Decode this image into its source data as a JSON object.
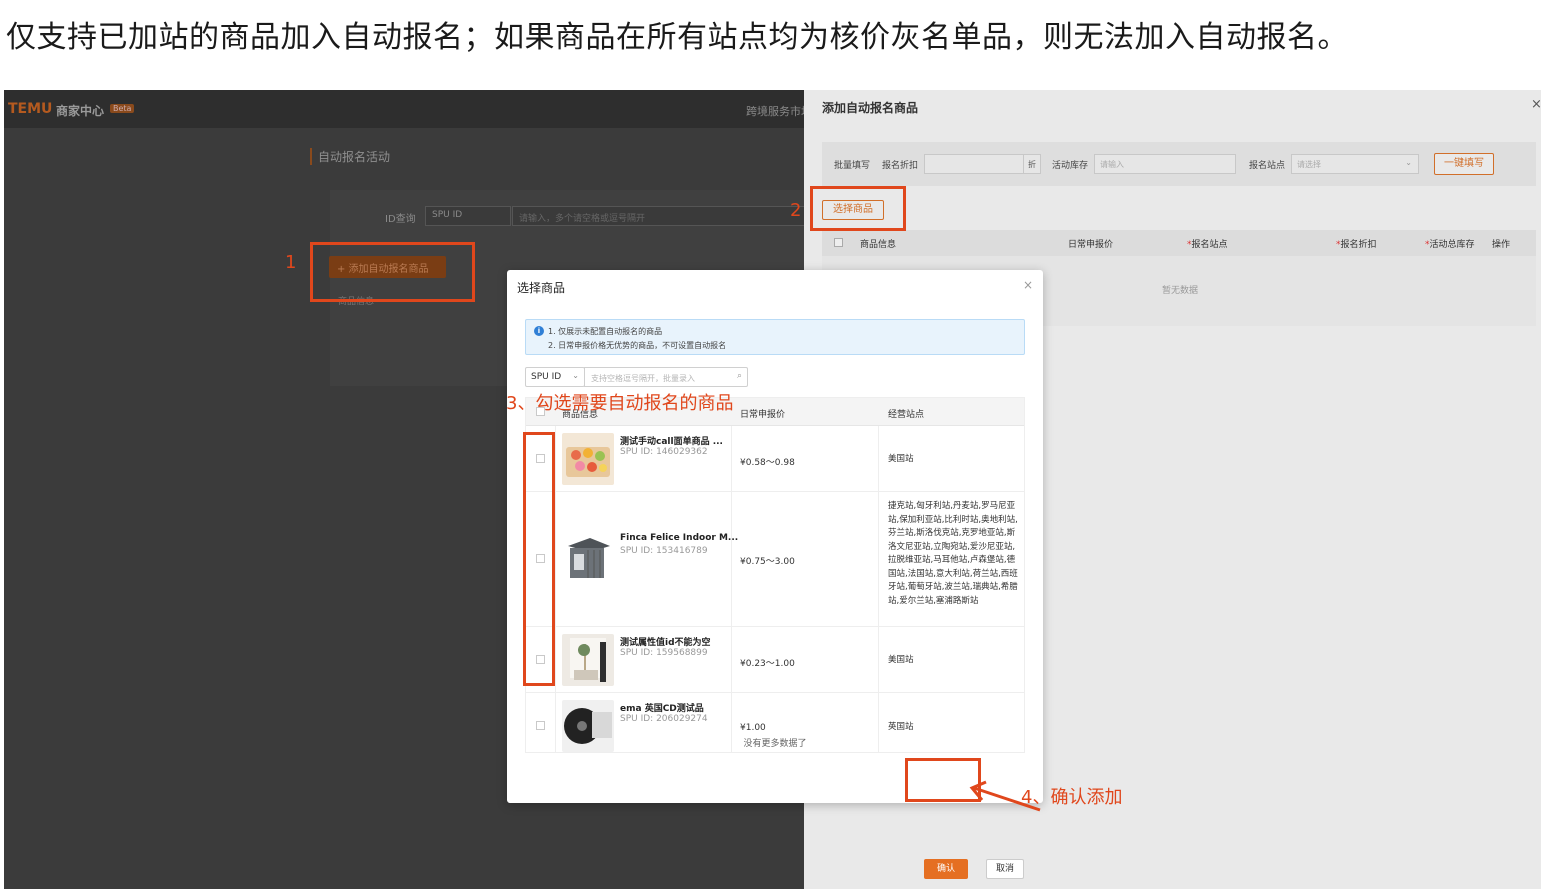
{
  "instruction": "仅支持已加站的商品加入自动报名；如果商品在所有站点均为核价灰名单品，则无法加入自动报名。",
  "base": {
    "logo": "TEMU",
    "brand": "商家中心",
    "beta": "Beta",
    "cross_service": "跨境服务市场",
    "page_title": "自动报名活动",
    "id_label": "ID查询",
    "id_select": "SPU ID",
    "id_placeholder": "请输入，多个请空格或逗号隔开",
    "add_button": "+ 添加自动报名商品",
    "col_header": "商品信息"
  },
  "drawer": {
    "title": "添加自动报名商品",
    "close": "×",
    "bulk_label": "批量填写",
    "discount_label": "报名折扣",
    "discount_suffix": "折",
    "stock_label": "活动库存",
    "stock_placeholder": "请输入",
    "site_label": "报名站点",
    "site_placeholder": "请选择",
    "one_click": "一键填写",
    "select_goods": "选择商品",
    "columns": [
      "商品信息",
      "日常申报价",
      "报名站点",
      "报名折扣",
      "活动总库存",
      "操作"
    ],
    "empty": "暂无数据"
  },
  "modal": {
    "title": "选择商品",
    "close": "×",
    "notice_1": "1. 仅展示未配置自动报名的商品",
    "notice_2": "2. 日常申报价格无优势的商品，不可设置自动报名",
    "spu_select": "SPU ID",
    "search_placeholder": "支持空格逗号隔开，批量录入",
    "columns": {
      "info": "商品信息",
      "price": "日常申报价",
      "sites": "经营站点"
    },
    "rows": [
      {
        "name": "测试手动call面单商品 ...",
        "spu": "SPU ID: 146029362",
        "price": "¥0.58～0.98",
        "sites": "美国站"
      },
      {
        "name": "Finca Felice Indoor M...",
        "spu": "SPU ID: 153416789",
        "price": "¥0.75～3.00",
        "sites": "捷克站,匈牙利站,丹麦站,罗马尼亚站,保加利亚站,比利时站,奥地利站,芬兰站,斯洛伐克站,克罗地亚站,斯洛文尼亚站,立陶宛站,爱沙尼亚站,拉脱维亚站,马耳他站,卢森堡站,德国站,法国站,意大利站,荷兰站,西班牙站,葡萄牙站,波兰站,瑞典站,希腊站,爱尔兰站,塞浦路斯站"
      },
      {
        "name": "测试属性值id不能为空",
        "spu": "SPU ID: 159568899",
        "price": "¥0.23～1.00",
        "sites": "美国站"
      },
      {
        "name": "ema 英国CD测试品",
        "spu": "SPU ID: 206029274",
        "price": "¥1.00",
        "sites": "英国站"
      }
    ],
    "no_more": "没有更多数据了",
    "confirm": "确认",
    "cancel": "取消"
  },
  "annotations": {
    "step1": "1",
    "step2": "2",
    "step3": "3、勾选需要自动报名的商品",
    "step4": "4、确认添加",
    "color": "#e0471c"
  }
}
